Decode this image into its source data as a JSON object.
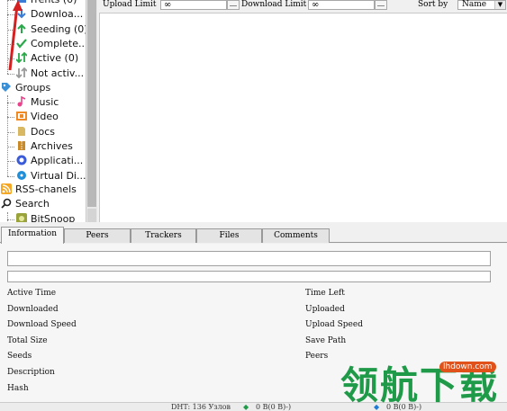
{
  "sidebar": {
    "torrents": [
      {
        "label": "rrents (0)",
        "icon": "torrents-icon",
        "color": "#3a7bd5"
      },
      {
        "label": "Downloa...",
        "icon": "download-icon",
        "color": "#3a7bd5"
      },
      {
        "label": "Seeding (0)",
        "icon": "seeding-icon",
        "color": "#2aa84a"
      },
      {
        "label": "Complete...",
        "icon": "complete-check-icon",
        "color": "#2aa84a"
      },
      {
        "label": "Active (0)",
        "icon": "active-arrows-icon",
        "color": "#2aa84a"
      },
      {
        "label": "Not activ...",
        "icon": "inactive-arrows-icon",
        "color": "#9a9a9a"
      }
    ],
    "groups_label": "Groups",
    "groups": [
      {
        "label": "Music",
        "icon": "music-icon",
        "color": "#e8438b"
      },
      {
        "label": "Video",
        "icon": "video-icon",
        "color": "#f08a24"
      },
      {
        "label": "Docs",
        "icon": "docs-icon",
        "color": "#d9b864"
      },
      {
        "label": "Archives",
        "icon": "archives-icon",
        "color": "#c98a2a"
      },
      {
        "label": "Applicati...",
        "icon": "applications-icon",
        "color": "#3b5bd9"
      },
      {
        "label": "Virtual Di...",
        "icon": "virtual-disk-icon",
        "color": "#1e8fd8"
      }
    ],
    "rss_label": "RSS-chanels",
    "search_label": "Search",
    "search_items": [
      {
        "label": "BitSnoop",
        "icon": "bitsnoop-icon",
        "color": "#9aa23a"
      }
    ]
  },
  "toolbar": {
    "upload_limit_label": "Upload Limit",
    "upload_limit_value": "∞",
    "download_limit_label": "Download Limit",
    "download_limit_value": "∞",
    "sort_by_label": "Sort by",
    "sort_value": "Name"
  },
  "tabs": [
    "Information",
    "Peers",
    "Trackers",
    "Files",
    "Comments"
  ],
  "info": {
    "left": [
      "Active Time",
      "Downloaded",
      "Download Speed",
      "Total Size",
      "Seeds",
      "Description",
      "Hash"
    ],
    "right": [
      "Time Left",
      "Uploaded",
      "Upload Speed",
      "Save Path",
      "Peers"
    ]
  },
  "status": {
    "dht": "DHT: 136 Узлов",
    "down": "0 B(0 B)-)",
    "up": "0 B(0 B)-)"
  },
  "watermark": {
    "text": "领航下载",
    "url": "lhdown.com"
  },
  "colors": {
    "accent_green": "#1f9a48",
    "watermark_url_bg": "#e0521a",
    "red_arrow": "#d42020"
  }
}
